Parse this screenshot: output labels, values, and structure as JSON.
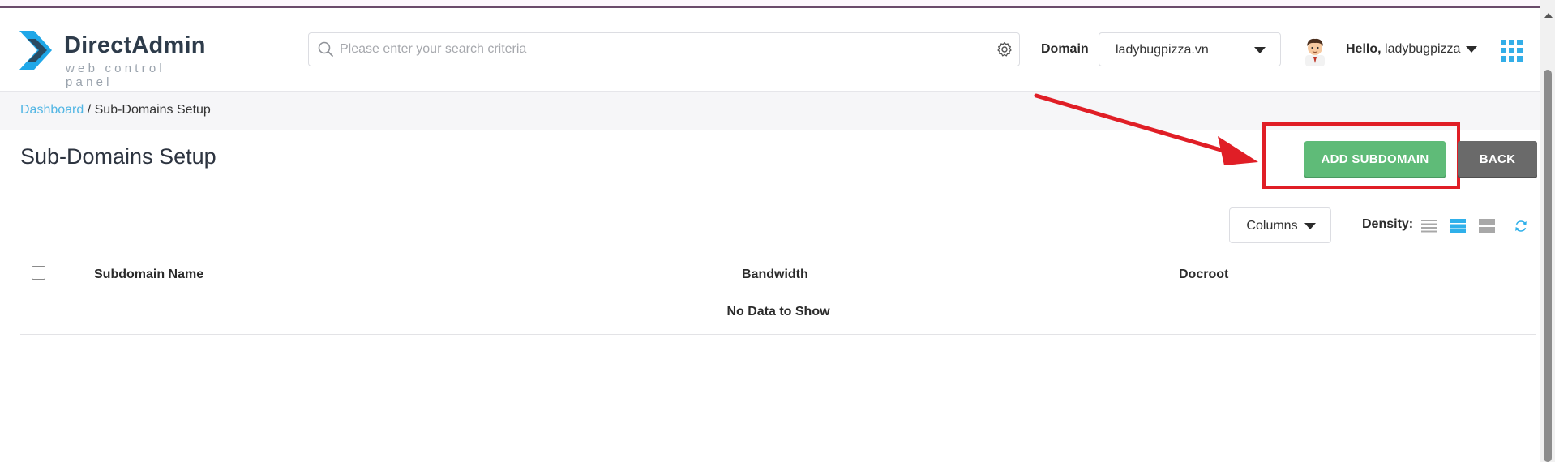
{
  "app": {
    "logo_name": "DirectAdmin",
    "logo_tagline": "web control panel"
  },
  "header": {
    "search_placeholder": "Please enter your search criteria",
    "domain_label": "Domain",
    "domain_value": "ladybugpizza.vn",
    "greeting": "Hello,",
    "username": "ladybugpizza"
  },
  "breadcrumb": {
    "home": "Dashboard",
    "separator": " / ",
    "current": "Sub-Domains Setup"
  },
  "page": {
    "title": "Sub-Domains Setup",
    "add_button": "ADD SUBDOMAIN",
    "back_button": "BACK"
  },
  "toolbar": {
    "columns_label": "Columns",
    "density_label": "Density:",
    "density_selected": "medium"
  },
  "table": {
    "columns": [
      "Subdomain Name",
      "Bandwidth",
      "Docroot"
    ],
    "empty_message": "No Data to Show"
  },
  "colors": {
    "accent": "#52b6e4",
    "add_button": "#5fbb78",
    "back_button": "#6a6a6a",
    "annotation": "#e01e26"
  },
  "icons": {
    "logo": "directadmin-logo-icon",
    "search": "search-icon",
    "settings": "gear-icon",
    "apps": "apps-grid-icon",
    "refresh": "refresh-icon"
  }
}
